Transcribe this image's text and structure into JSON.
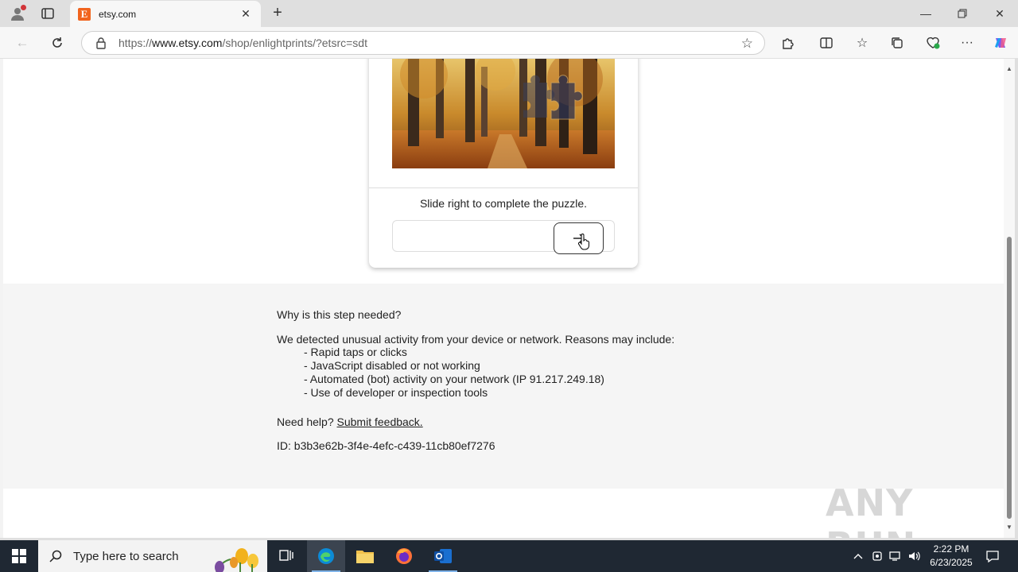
{
  "browser": {
    "tab_title": "etsy.com",
    "tab_favicon_letter": "E",
    "url_prefix": "https://",
    "url_host": "www.etsy.com",
    "url_path": "/shop/enlightprints/?etsrc=sdt"
  },
  "captcha": {
    "instruction": "Slide right to complete the puzzle.",
    "slider_icon": "arrow-right-icon"
  },
  "info": {
    "why": "Why is this step needed?",
    "detected": "We detected unusual activity from your device or network. Reasons may include:",
    "reasons": [
      "- Rapid taps or clicks",
      "- JavaScript disabled or not working",
      "- Automated (bot) activity on your network (IP 91.217.249.18)",
      "- Use of developer or inspection tools"
    ],
    "help_prefix": "Need help?",
    "help_link": "Submit feedback.",
    "request_id": "ID: b3b3e62b-3f4e-4efc-c439-11cb80ef7276"
  },
  "watermark": "ANY RUN",
  "taskbar": {
    "search_placeholder": "Type here to search",
    "time": "2:22 PM",
    "date": "6/23/2025"
  },
  "colors": {
    "etsy_orange": "#f1641e",
    "taskbar_bg": "#1f2833",
    "edge_blue": "#0c8bd6"
  }
}
